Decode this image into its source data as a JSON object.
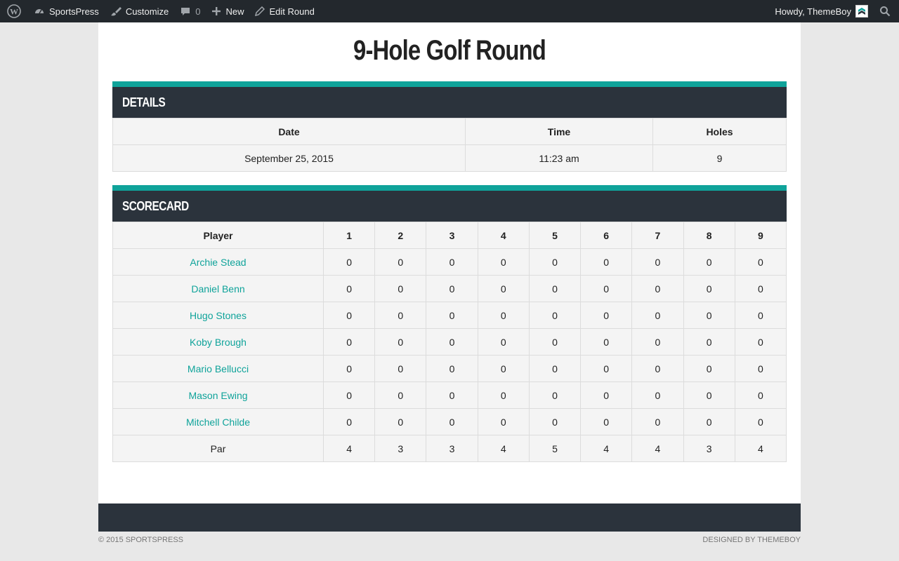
{
  "adminbar": {
    "site_name": "SportsPress",
    "customize": "Customize",
    "comments_count": "0",
    "new": "New",
    "edit": "Edit Round",
    "howdy": "Howdy, ThemeBoy"
  },
  "page": {
    "title": "9-Hole Golf Round"
  },
  "details": {
    "heading": "DETAILS",
    "columns": [
      "Date",
      "Time",
      "Holes"
    ],
    "values": [
      "September 25, 2015",
      "11:23 am",
      "9"
    ]
  },
  "scorecard": {
    "heading": "SCORECARD",
    "columns": [
      "Player",
      "1",
      "2",
      "3",
      "4",
      "5",
      "6",
      "7",
      "8",
      "9"
    ],
    "rows": [
      {
        "name": "Archie Stead",
        "scores": [
          "0",
          "0",
          "0",
          "0",
          "0",
          "0",
          "0",
          "0",
          "0"
        ]
      },
      {
        "name": "Daniel Benn",
        "scores": [
          "0",
          "0",
          "0",
          "0",
          "0",
          "0",
          "0",
          "0",
          "0"
        ]
      },
      {
        "name": "Hugo Stones",
        "scores": [
          "0",
          "0",
          "0",
          "0",
          "0",
          "0",
          "0",
          "0",
          "0"
        ]
      },
      {
        "name": "Koby Brough",
        "scores": [
          "0",
          "0",
          "0",
          "0",
          "0",
          "0",
          "0",
          "0",
          "0"
        ]
      },
      {
        "name": "Mario Bellucci",
        "scores": [
          "0",
          "0",
          "0",
          "0",
          "0",
          "0",
          "0",
          "0",
          "0"
        ]
      },
      {
        "name": "Mason Ewing",
        "scores": [
          "0",
          "0",
          "0",
          "0",
          "0",
          "0",
          "0",
          "0",
          "0"
        ]
      },
      {
        "name": "Mitchell Childe",
        "scores": [
          "0",
          "0",
          "0",
          "0",
          "0",
          "0",
          "0",
          "0",
          "0"
        ]
      }
    ],
    "par": {
      "label": "Par",
      "values": [
        "4",
        "3",
        "3",
        "4",
        "5",
        "4",
        "4",
        "3",
        "4"
      ]
    }
  },
  "footer": {
    "copyright": "© 2015 SPORTSPRESS",
    "credit": "DESIGNED BY THEMEBOY"
  },
  "colors": {
    "accent": "#0fa39a",
    "header_dark": "#2b333c",
    "adminbar": "#23282d"
  },
  "icons": [
    "wordpress-icon",
    "dashboard-icon",
    "brush-icon",
    "comment-icon",
    "plus-icon",
    "pencil-icon",
    "search-icon"
  ]
}
